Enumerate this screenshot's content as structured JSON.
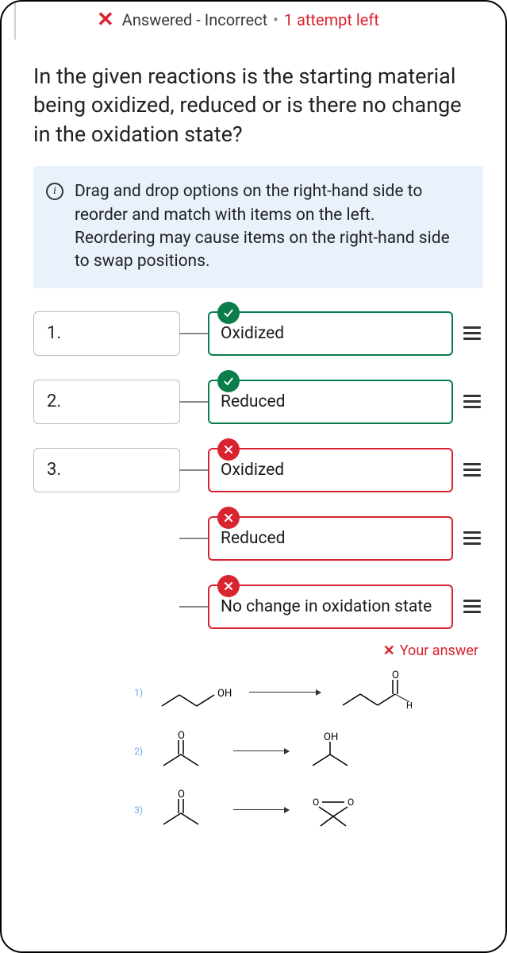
{
  "status": {
    "icon": "x",
    "text": "Answered - Incorrect",
    "attempts": "1 attempt left"
  },
  "question": "In the given reactions is the starting material being oxidized, reduced or is there no change in the oxidation state?",
  "info": "Drag and drop options on the right-hand side to reorder and match with items on the left.\nReordering may cause items on the right-hand side to swap positions.",
  "left_items": [
    "1.",
    "2.",
    "3.",
    "",
    ""
  ],
  "right_items": [
    {
      "label": "Oxidized",
      "state": "correct"
    },
    {
      "label": "Reduced",
      "state": "correct"
    },
    {
      "label": "Oxidized",
      "state": "incorrect"
    },
    {
      "label": "Reduced",
      "state": "incorrect"
    },
    {
      "label": "No change in oxidation state",
      "state": "incorrect"
    }
  ],
  "your_answer_label": "Your answer",
  "reactions": [
    {
      "num": "1)",
      "left_label": "OH",
      "right_top": "O",
      "right_side": "H"
    },
    {
      "num": "2)",
      "left_top": "O",
      "right_top": "OH"
    },
    {
      "num": "3)",
      "left_top": "O"
    }
  ]
}
